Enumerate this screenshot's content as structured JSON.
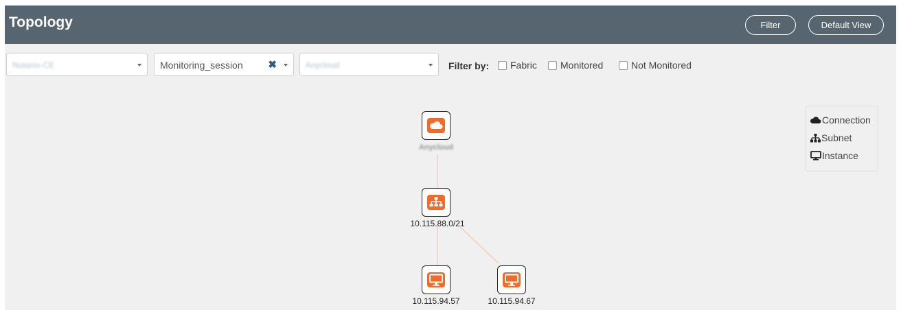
{
  "header": {
    "title": "Topology",
    "filter_label": "Filter",
    "default_view_label": "Default View"
  },
  "toolbar": {
    "select1": "Nutanix-CE",
    "select2": "Monitoring_session",
    "select3": "Anycloud",
    "filter_by": "Filter by:",
    "checkboxes": [
      {
        "label": "Fabric",
        "checked": false
      },
      {
        "label": "Monitored",
        "checked": false
      },
      {
        "label": "Not Monitored",
        "checked": false
      }
    ]
  },
  "legend": {
    "connection": "Connection",
    "subnet": "Subnet",
    "instance": "Instance"
  },
  "nodes": {
    "cloud": "Anycloud",
    "subnet": "10.115.88.0/21",
    "instance1": "10.115.94.57",
    "instance2": "10.115.94.67"
  },
  "colors": {
    "accent": "#f26b2a",
    "header_bg": "#56656f",
    "edge": "#f4c9b8",
    "canvas_bg": "#f0f0f0"
  }
}
